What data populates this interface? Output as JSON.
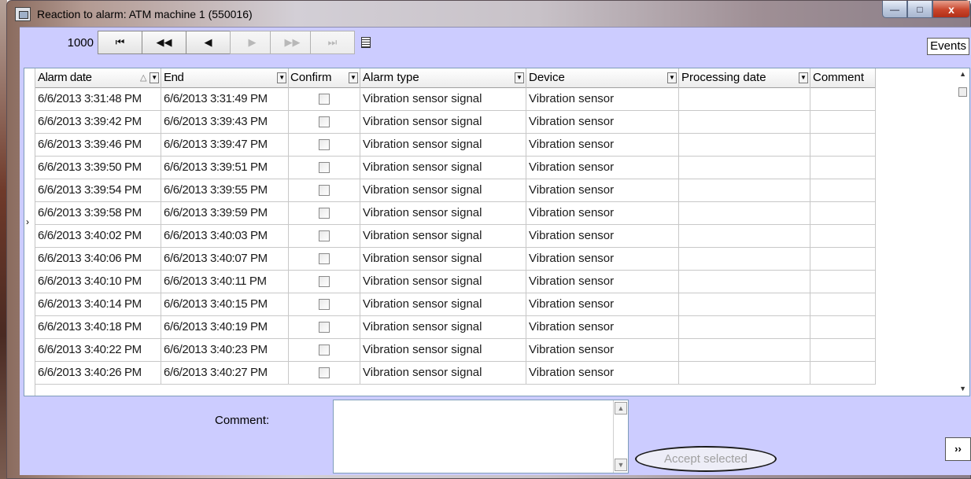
{
  "window": {
    "title": "Reaction to alarm: ATM machine 1 (550016)",
    "minimize": "—",
    "maximize": "□",
    "close": "x"
  },
  "toolbar": {
    "count": "1000",
    "first": "⏮",
    "prev_page": "◀◀",
    "prev": "◀",
    "next": "▶",
    "next_page": "▶▶",
    "last": "⏭",
    "events_label": "Events"
  },
  "grid": {
    "columns": [
      "Alarm date",
      "End",
      "Confirm",
      "Alarm type",
      "Device",
      "Processing date",
      "Comment"
    ],
    "sort_indicator": "△",
    "rows": [
      {
        "alarm_date": "6/6/2013 3:31:48 PM",
        "end": "6/6/2013 3:31:49 PM",
        "type": "Vibration sensor signal",
        "device": "Vibration sensor",
        "processing": "",
        "comment": ""
      },
      {
        "alarm_date": "6/6/2013 3:39:42 PM",
        "end": "6/6/2013 3:39:43 PM",
        "type": "Vibration sensor signal",
        "device": "Vibration sensor",
        "processing": "",
        "comment": ""
      },
      {
        "alarm_date": "6/6/2013 3:39:46 PM",
        "end": "6/6/2013 3:39:47 PM",
        "type": "Vibration sensor signal",
        "device": "Vibration sensor",
        "processing": "",
        "comment": ""
      },
      {
        "alarm_date": "6/6/2013 3:39:50 PM",
        "end": "6/6/2013 3:39:51 PM",
        "type": "Vibration sensor signal",
        "device": "Vibration sensor",
        "processing": "",
        "comment": ""
      },
      {
        "alarm_date": "6/6/2013 3:39:54 PM",
        "end": "6/6/2013 3:39:55 PM",
        "type": "Vibration sensor signal",
        "device": "Vibration sensor",
        "processing": "",
        "comment": ""
      },
      {
        "alarm_date": "6/6/2013 3:39:58 PM",
        "end": "6/6/2013 3:39:59 PM",
        "type": "Vibration sensor signal",
        "device": "Vibration sensor",
        "processing": "",
        "comment": ""
      },
      {
        "alarm_date": "6/6/2013 3:40:02 PM",
        "end": "6/6/2013 3:40:03 PM",
        "type": "Vibration sensor signal",
        "device": "Vibration sensor",
        "processing": "",
        "comment": ""
      },
      {
        "alarm_date": "6/6/2013 3:40:06 PM",
        "end": "6/6/2013 3:40:07 PM",
        "type": "Vibration sensor signal",
        "device": "Vibration sensor",
        "processing": "",
        "comment": ""
      },
      {
        "alarm_date": "6/6/2013 3:40:10 PM",
        "end": "6/6/2013 3:40:11 PM",
        "type": "Vibration sensor signal",
        "device": "Vibration sensor",
        "processing": "",
        "comment": ""
      },
      {
        "alarm_date": "6/6/2013 3:40:14 PM",
        "end": "6/6/2013 3:40:15 PM",
        "type": "Vibration sensor signal",
        "device": "Vibration sensor",
        "processing": "",
        "comment": ""
      },
      {
        "alarm_date": "6/6/2013 3:40:18 PM",
        "end": "6/6/2013 3:40:19 PM",
        "type": "Vibration sensor signal",
        "device": "Vibration sensor",
        "processing": "",
        "comment": ""
      },
      {
        "alarm_date": "6/6/2013 3:40:22 PM",
        "end": "6/6/2013 3:40:23 PM",
        "type": "Vibration sensor signal",
        "device": "Vibration sensor",
        "processing": "",
        "comment": ""
      },
      {
        "alarm_date": "6/6/2013 3:40:26 PM",
        "end": "6/6/2013 3:40:27 PM",
        "type": "Vibration sensor signal",
        "device": "Vibration sensor",
        "processing": "",
        "comment": ""
      }
    ]
  },
  "bottom": {
    "comment_label": "Comment:",
    "comment_value": "",
    "accept_label": "Accept selected",
    "expand_label": "››"
  }
}
